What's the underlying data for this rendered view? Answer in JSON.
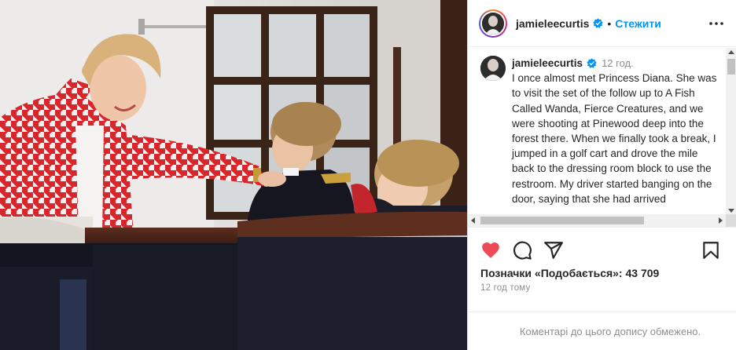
{
  "post": {
    "username": "jamieleecurtis",
    "dot": "•",
    "follow_label": "Стежити",
    "more_icon": "more-options-icon",
    "caption": {
      "username": "jamieleecurtis",
      "timestamp": "12 год.",
      "text": "I once almost met Princess Diana. She was to visit the set of the follow up to A Fish Called Wanda, Fierce Creatures, and we were shooting at Pinewood deep into the forest there. When we finally took a break, I jumped in a golf cart and drove the mile back to the dressing room block to use the restroom. My driver started banging on the door, saying that she had arrived"
    },
    "likes_text": "Позначки «Подобається»: 43 709",
    "time_ago": "12 год тому",
    "comments_disabled": "Коментарі до цього допису обмежено."
  },
  "colors": {
    "accent_blue": "#0095f6",
    "like_red": "#ed4956",
    "muted_text": "#8e8e8e"
  },
  "icons": [
    "heart-icon",
    "comment-icon",
    "share-icon",
    "bookmark-icon",
    "verified-badge-icon"
  ]
}
